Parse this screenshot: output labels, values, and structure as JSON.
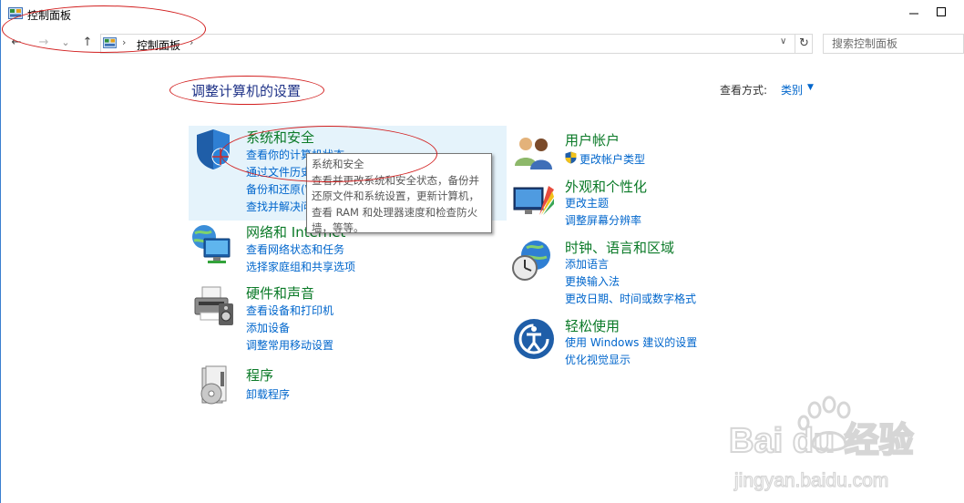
{
  "window": {
    "title": "控制面板"
  },
  "address": {
    "path": "控制面板",
    "search_placeholder": "搜索控制面板"
  },
  "nav": {
    "back": "←",
    "forward": "→",
    "recent": "⌄",
    "up": "↑",
    "separator": "›",
    "dropdown": "∨",
    "refresh": "↻"
  },
  "main": {
    "heading": "调整计算机的设置",
    "view_by_label": "查看方式:",
    "view_by_value": "类别"
  },
  "categories": [
    {
      "title": "系统和安全",
      "icon": "shield-icon",
      "links": [
        "查看你的计算机状态",
        "通过文件历史记录保存你的文件备份副本",
        "备份和还原(Windows 7)",
        "查找并解决问题"
      ]
    },
    {
      "title": "网络和 Internet",
      "icon": "network-icon",
      "links": [
        "查看网络状态和任务",
        "选择家庭组和共享选项"
      ]
    },
    {
      "title": "硬件和声音",
      "icon": "printer-icon",
      "links": [
        "查看设备和打印机",
        "添加设备",
        "调整常用移动设置"
      ]
    },
    {
      "title": "程序",
      "icon": "programs-icon",
      "links": [
        "卸载程序"
      ]
    },
    {
      "title": "用户帐户",
      "icon": "users-icon",
      "links": [
        "更改帐户类型"
      ]
    },
    {
      "title": "外观和个性化",
      "icon": "appearance-icon",
      "links": [
        "更改主题",
        "调整屏幕分辨率"
      ]
    },
    {
      "title": "时钟、语言和区域",
      "icon": "clock-globe-icon",
      "links": [
        "添加语言",
        "更换输入法",
        "更改日期、时间或数字格式"
      ]
    },
    {
      "title": "轻松使用",
      "icon": "ease-of-access-icon",
      "links": [
        "使用 Windows 建议的设置",
        "优化视觉显示"
      ]
    }
  ],
  "tooltip": {
    "lines": [
      "系统和安全",
      "查看并更改系统和安全状态，备份并",
      "还原文件和系统设置，更新计算机，",
      "查看 RAM 和处理器速度和检查防火",
      "墙，等等。"
    ]
  },
  "watermark": {
    "brand": "Bai du 经验",
    "url": "jingyan.baidu.com"
  },
  "colors": {
    "category_title": "#0b7a28",
    "link": "#0066cc",
    "heading": "#1e3287",
    "highlight": "#e5f3fb",
    "annotation": "#d21f1f"
  }
}
